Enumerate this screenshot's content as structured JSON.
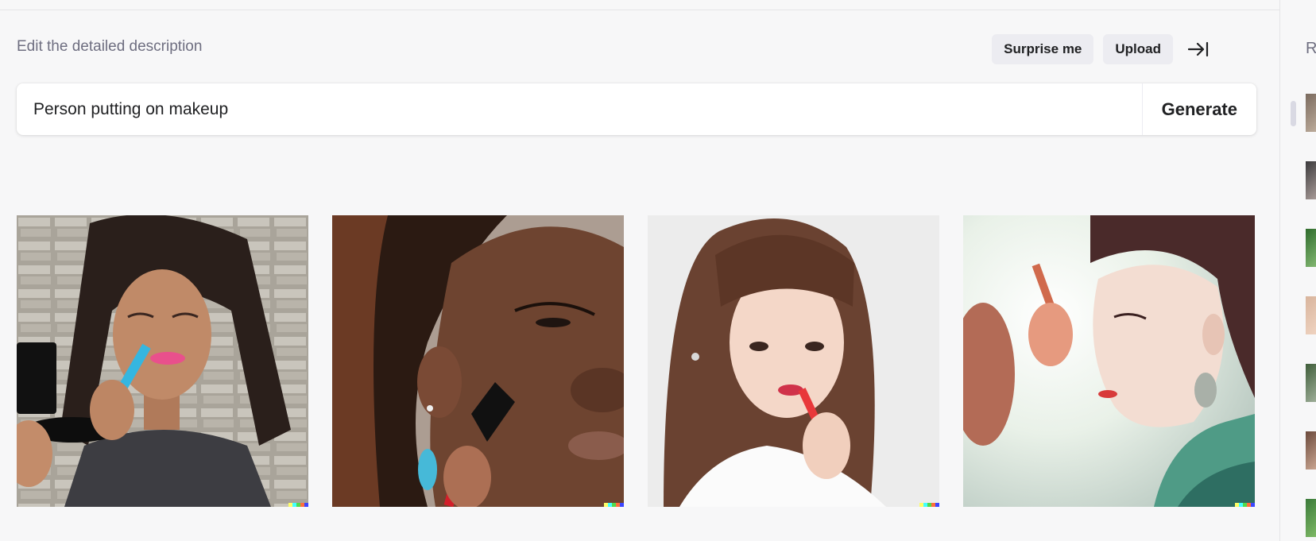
{
  "editor": {
    "heading": "Edit the detailed description",
    "surprise_label": "Surprise me",
    "upload_label": "Upload",
    "prompt_value": "Person putting on makeup",
    "generate_label": "Generate"
  },
  "results": [
    {
      "subject": "Woman applying pink lipstick while holding a compact mirror"
    },
    {
      "subject": "Close-up of a woman applying blush with a brush"
    },
    {
      "subject": "Young woman applying lip gloss"
    },
    {
      "subject": "Stylized portrait of a person applying makeup"
    }
  ],
  "signature_colors": [
    "#ffff66",
    "#42ffff",
    "#51da4c",
    "#ff6e3c",
    "#3c46ff"
  ],
  "sidebar": {
    "heading": "R",
    "history_count": 7
  }
}
